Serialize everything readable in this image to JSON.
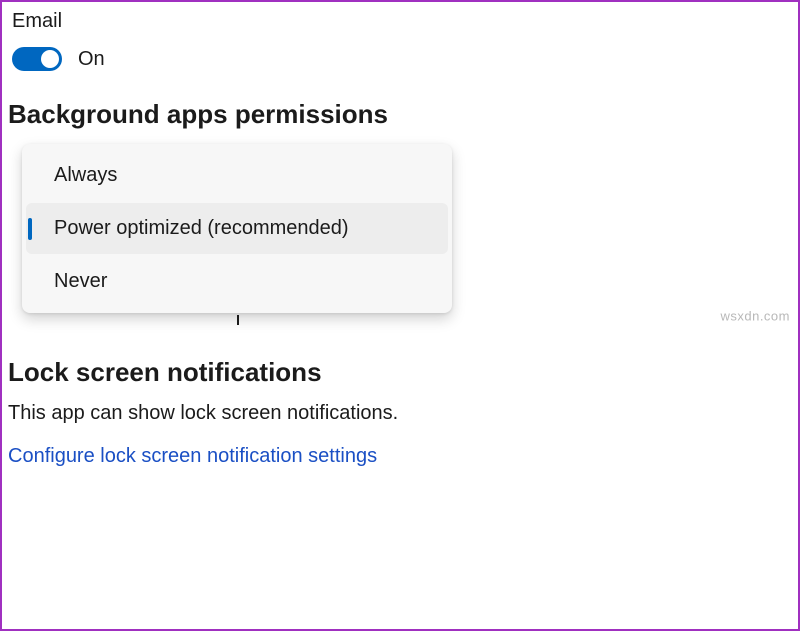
{
  "email": {
    "label": "Email",
    "toggle_state": "On",
    "toggle_on": true
  },
  "background_apps": {
    "header": "Background apps permissions",
    "options": [
      {
        "label": "Always",
        "selected": false
      },
      {
        "label": "Power optimized (recommended)",
        "selected": true
      },
      {
        "label": "Never",
        "selected": false
      }
    ]
  },
  "lock_screen": {
    "header": "Lock screen notifications",
    "description": "This app can show lock screen notifications.",
    "link": "Configure lock screen notification settings"
  },
  "watermark": "wsxdn.com"
}
